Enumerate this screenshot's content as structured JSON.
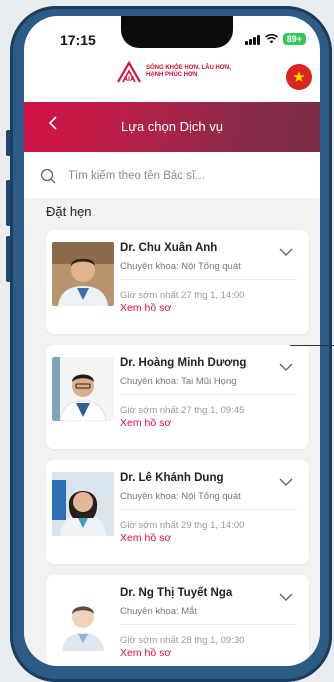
{
  "status_bar": {
    "time": "17:15",
    "battery": "89+"
  },
  "brand": {
    "logo_text": "AIA",
    "slogan_line1": "SỐNG KHỎE HƠN, LÂU HƠN,",
    "slogan_line2": "HẠNH PHÚC HƠN"
  },
  "header": {
    "title": "Lựa chọn Dịch vụ"
  },
  "search": {
    "placeholder": "Tìm kiếm theo tên Bác sĩ..."
  },
  "section_title": "Đặt hẹn",
  "doctors": [
    {
      "name": "Dr. Chu Xuân Anh",
      "specialty": "Chuyên khoa: Nội Tổng quát",
      "earliest": "Giờ sớm nhất 27 thg 1, 14:00",
      "profile_link": "Xem hồ sơ"
    },
    {
      "name": "Dr. Hoàng Minh Dương",
      "specialty": "Chuyên khoa: Tai Mũi Họng",
      "earliest": "Giờ sớm nhất 27 thg 1, 09:45",
      "profile_link": "Xem hồ sơ"
    },
    {
      "name": "Dr. Lê Khánh Dung",
      "specialty": "Chuyên khoa: Nội Tổng quát",
      "earliest": "Giờ sớm nhất 29 thg 1, 14:00",
      "profile_link": "Xem hồ sơ"
    },
    {
      "name": "Dr. Ng Thị Tuyết Nga",
      "specialty": "Chuyên khoa: Mắt",
      "earliest": "Giờ sớm nhất 28 thg 1, 09:30",
      "profile_link": "Xem hồ sơ"
    }
  ],
  "colors": {
    "brand": "#d31145",
    "header_dark": "#7a2e48",
    "phone_frame": "#2c5b86"
  }
}
